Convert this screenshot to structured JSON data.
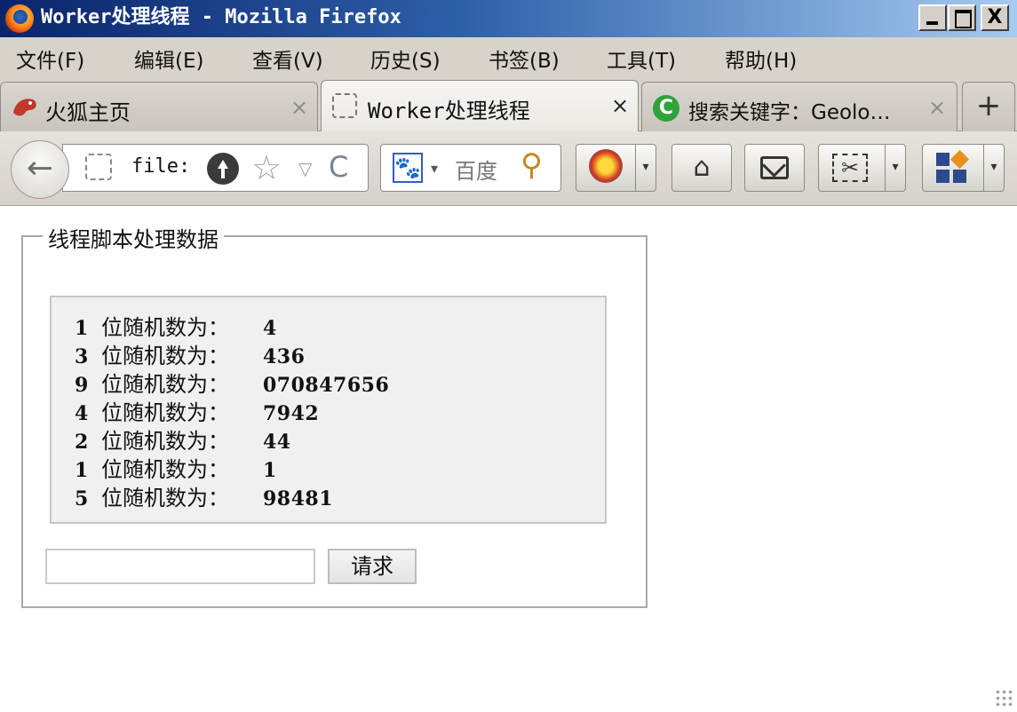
{
  "window": {
    "title": "Worker处理线程 - Mozilla Firefox",
    "controls": {
      "minimize": "_",
      "maximize": "□",
      "close": "X"
    }
  },
  "menu": [
    "文件(F)",
    "编辑(E)",
    "查看(V)",
    "历史(S)",
    "书签(B)",
    "工具(T)",
    "帮助(H)"
  ],
  "tabs": [
    {
      "label": "火狐主页",
      "icon": "firefox-fox-icon",
      "active": false
    },
    {
      "label": "Worker处理线程",
      "icon": "blank-page-icon",
      "active": true
    },
    {
      "label": "搜索关键字：Geolo…",
      "icon": "green-c-icon",
      "active": false
    }
  ],
  "tab_close": "×",
  "new_tab": "+",
  "navbar": {
    "url": "file:",
    "search_engine": "百度",
    "back_glyph": "←",
    "star_glyph": "☆",
    "dropdown_glyph": "▽",
    "reload_glyph": "C",
    "split_glyph": "▾",
    "home_glyph": "⌂",
    "search_glyph": "🔍"
  },
  "page": {
    "legend": "线程脚本处理数据",
    "results": [
      {
        "digits": "1",
        "label": "位随机数为：",
        "value": "4"
      },
      {
        "digits": "3",
        "label": "位随机数为：",
        "value": "436"
      },
      {
        "digits": "9",
        "label": "位随机数为：",
        "value": "070847656"
      },
      {
        "digits": "4",
        "label": "位随机数为：",
        "value": "7942"
      },
      {
        "digits": "2",
        "label": "位随机数为：",
        "value": "44"
      },
      {
        "digits": "1",
        "label": "位随机数为：",
        "value": "1"
      },
      {
        "digits": "5",
        "label": "位随机数为：",
        "value": "98481"
      }
    ],
    "input_value": "",
    "button_label": "请求"
  },
  "colors": {
    "titlebar_start": "#0a246a",
    "titlebar_end": "#a6caf0",
    "chrome": "#d7d3ca",
    "result_bg": "#f0f0f0"
  }
}
